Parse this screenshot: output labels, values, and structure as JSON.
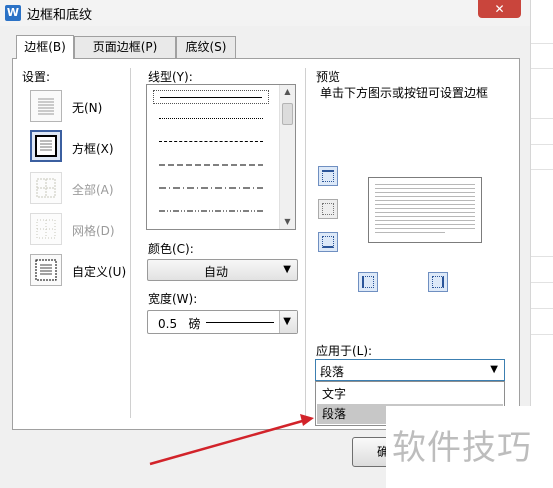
{
  "window": {
    "title": "边框和底纹",
    "app_icon_letter": "W",
    "close_glyph": "✕"
  },
  "tabs": [
    {
      "label": "边框(B)",
      "active": true
    },
    {
      "label": "页面边框(P)",
      "active": false
    },
    {
      "label": "底纹(S)",
      "active": false
    }
  ],
  "settings": {
    "heading": "设置:",
    "items": [
      {
        "label": "无(N)",
        "state": "normal"
      },
      {
        "label": "方框(X)",
        "state": "selected"
      },
      {
        "label": "全部(A)",
        "state": "disabled"
      },
      {
        "label": "网格(D)",
        "state": "disabled"
      },
      {
        "label": "自定义(U)",
        "state": "normal"
      }
    ]
  },
  "line_style": {
    "label": "线型(Y):",
    "styles": [
      "solid",
      "dotted",
      "dashed",
      "dashed-long",
      "dash-dot",
      "dash-dot-dot"
    ]
  },
  "color": {
    "label": "颜色(C):",
    "value": "自动",
    "arrow": "▼"
  },
  "width": {
    "label": "宽度(W):",
    "value": "0.5   磅",
    "arrow": "▼"
  },
  "preview": {
    "heading": "预览",
    "hint": "单击下方图示或按钮可设置边框"
  },
  "apply_to": {
    "label": "应用于(L):",
    "value": "段落",
    "arrow": "▼",
    "options": [
      "文字",
      "段落"
    ],
    "highlighted": "段落"
  },
  "ok_button": {
    "label": "确"
  },
  "watermark": {
    "text": "软件技巧"
  },
  "colors": {
    "accent": "#3b5fa0",
    "close": "#c9453c",
    "arrow": "#d2232a",
    "highlight": "#c7c7c7"
  }
}
